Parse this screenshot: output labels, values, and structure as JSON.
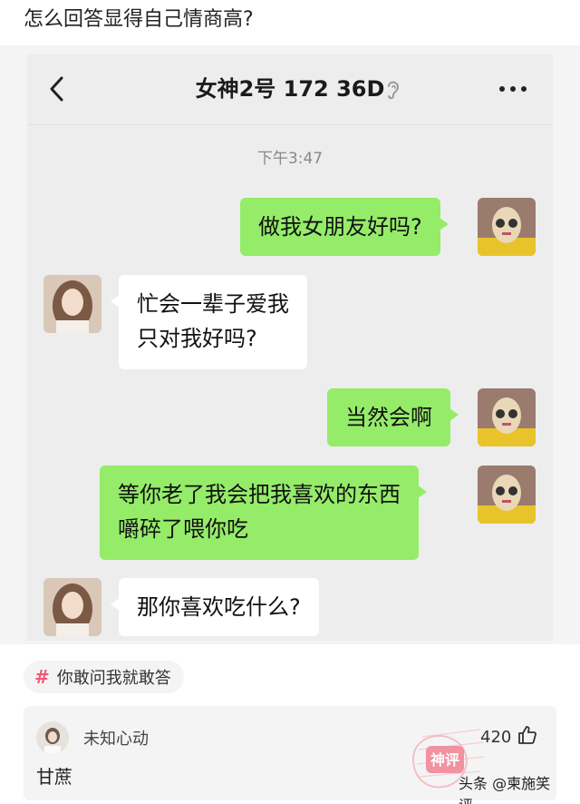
{
  "question": {
    "title": "怎么回答显得自己情商高?"
  },
  "chat": {
    "title": "女神2号 172  36D",
    "time": "下午3:47",
    "messages": [
      {
        "from": "me",
        "lines": [
          "做我女朋友好吗?"
        ]
      },
      {
        "from": "them",
        "lines": [
          "忙会一辈子爱我",
          "只对我好吗?"
        ]
      },
      {
        "from": "me",
        "lines": [
          "当然会啊"
        ]
      },
      {
        "from": "me",
        "lines": [
          "等你老了我会把我喜欢的东西",
          "嚼碎了喂你吃"
        ]
      },
      {
        "from": "them",
        "lines": [
          "那你喜欢吃什么?"
        ]
      }
    ]
  },
  "topic": {
    "hash": "#",
    "label": "你敢问我就敢答"
  },
  "comment": {
    "user": "未知心动",
    "likes": "420",
    "text": "甘蔗"
  },
  "stamp": {
    "label": "神评"
  },
  "watermark": {
    "text": "头条 @柬施笑评"
  },
  "colors": {
    "my_bubble": "#95ec69",
    "their_bubble": "#ffffff",
    "chat_bg": "#ededed",
    "topic_hash": "#f0587a",
    "stamp": "#f07a8c"
  },
  "icons": [
    "back-chevron-icon",
    "ear-icon",
    "more-dots-icon",
    "hash-icon",
    "thumbs-up-icon"
  ]
}
